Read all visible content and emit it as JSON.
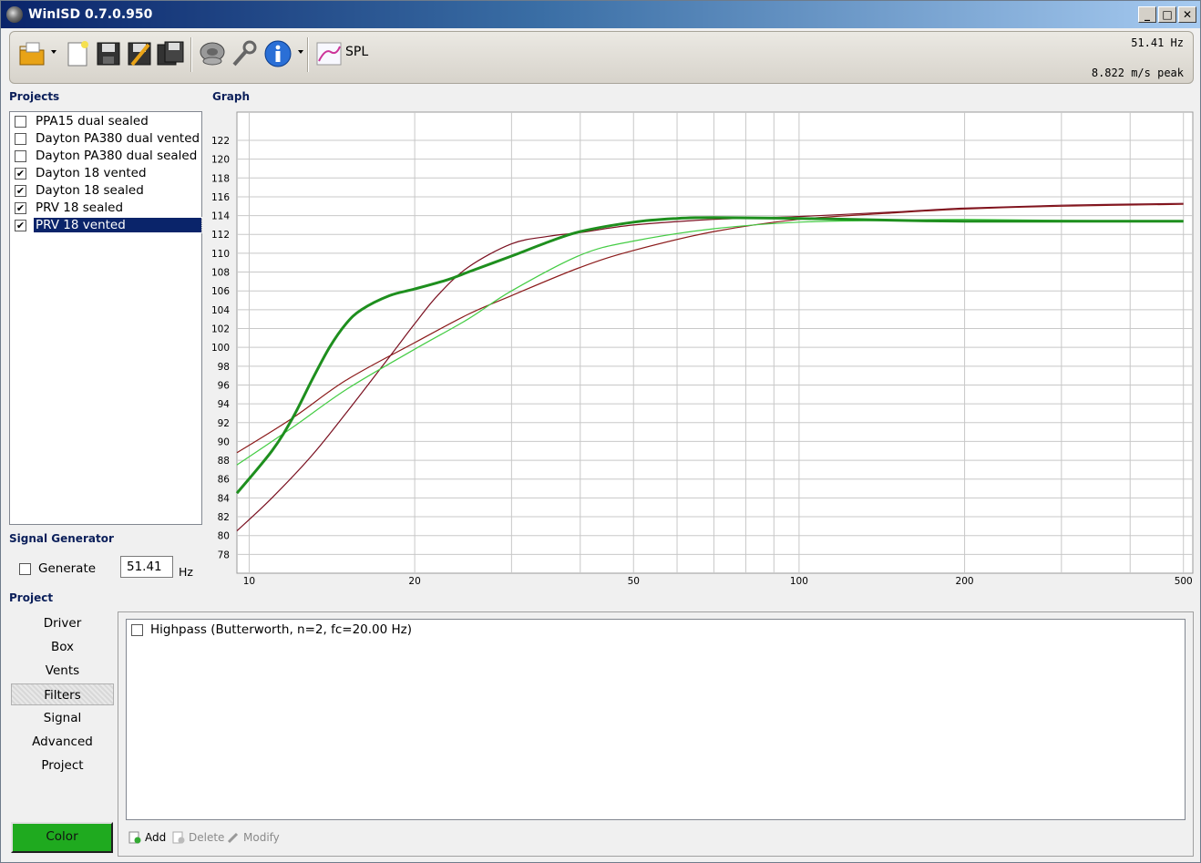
{
  "window": {
    "title": "WinISD 0.7.0.950",
    "min": "_",
    "max": "□",
    "close": "✕"
  },
  "toolbar": {
    "icons": [
      "open-folder-icon",
      "new-file-icon",
      "save-icon",
      "save-as-icon",
      "save-all-icon",
      "speaker-icon",
      "wrench-icon",
      "info-icon",
      "spl-graph-icon"
    ],
    "graph_label": "SPL",
    "frequency_readout": "51.41 Hz",
    "excursion_readout": "8.822 m/s peak"
  },
  "projects": {
    "label": "Projects",
    "items": [
      {
        "label": "PPA15 dual sealed",
        "checked": false,
        "selected": false
      },
      {
        "label": "Dayton PA380 dual vented",
        "checked": false,
        "selected": false
      },
      {
        "label": "Dayton PA380 dual sealed",
        "checked": false,
        "selected": false
      },
      {
        "label": "Dayton 18 vented",
        "checked": true,
        "selected": false
      },
      {
        "label": "Dayton 18 sealed",
        "checked": true,
        "selected": false
      },
      {
        "label": "PRV 18 sealed",
        "checked": true,
        "selected": false
      },
      {
        "label": "PRV 18 vented",
        "checked": true,
        "selected": true
      }
    ]
  },
  "signal_generator": {
    "label": "Signal Generator",
    "generate_label": "Generate",
    "frequency_value": "51.41",
    "unit": "Hz"
  },
  "graph": {
    "label": "Graph"
  },
  "chart_data": {
    "type": "line",
    "title": "",
    "xlabel": "",
    "ylabel": "",
    "x_scale": "log",
    "xlim": [
      9.5,
      520
    ],
    "ylim": [
      76,
      125
    ],
    "x_ticks": [
      10,
      20,
      50,
      100,
      200,
      500
    ],
    "x_gridlines": [
      10,
      20,
      30,
      40,
      50,
      60,
      70,
      80,
      90,
      100,
      200,
      300,
      400,
      500
    ],
    "y_ticks": [
      78,
      80,
      82,
      84,
      86,
      88,
      90,
      92,
      94,
      96,
      98,
      100,
      102,
      104,
      106,
      108,
      110,
      112,
      114,
      116,
      118,
      120,
      122
    ],
    "grid": true,
    "legend": "none",
    "series": [
      {
        "color": "#8b1a1a",
        "width": 1.2,
        "points": [
          [
            9.5,
            88.8
          ],
          [
            12,
            92.5
          ],
          [
            15,
            96.5
          ],
          [
            20,
            100.5
          ],
          [
            25,
            103.5
          ],
          [
            30,
            105.5
          ],
          [
            40,
            108.5
          ],
          [
            50,
            110.3
          ],
          [
            70,
            112.3
          ],
          [
            100,
            113.6
          ],
          [
            150,
            114.3
          ],
          [
            200,
            114.7
          ],
          [
            300,
            115
          ],
          [
            500,
            115.2
          ]
        ]
      },
      {
        "color": "#7a1020",
        "width": 1.2,
        "points": [
          [
            9.5,
            80.5
          ],
          [
            11,
            84
          ],
          [
            13,
            88.5
          ],
          [
            15,
            93
          ],
          [
            18,
            99
          ],
          [
            20,
            102.5
          ],
          [
            22,
            105.5
          ],
          [
            25,
            108.5
          ],
          [
            30,
            111
          ],
          [
            35,
            111.8
          ],
          [
            40,
            112.2
          ],
          [
            50,
            113
          ],
          [
            70,
            113.6
          ],
          [
            100,
            113.9
          ],
          [
            150,
            114.4
          ],
          [
            200,
            114.8
          ],
          [
            300,
            115.1
          ],
          [
            500,
            115.3
          ]
        ]
      },
      {
        "color": "#44cc44",
        "width": 1.2,
        "points": [
          [
            9.5,
            87.5
          ],
          [
            12,
            91.5
          ],
          [
            15,
            95.5
          ],
          [
            20,
            99.8
          ],
          [
            25,
            103
          ],
          [
            30,
            106
          ],
          [
            40,
            109.8
          ],
          [
            50,
            111.3
          ],
          [
            70,
            112.6
          ],
          [
            100,
            113.3
          ],
          [
            150,
            113.5
          ],
          [
            200,
            113.6
          ],
          [
            300,
            113.5
          ],
          [
            500,
            113.4
          ]
        ]
      },
      {
        "color": "#1e8f1e",
        "width": 3,
        "points": [
          [
            9.5,
            84.5
          ],
          [
            11,
            89
          ],
          [
            12,
            92.5
          ],
          [
            13,
            96.5
          ],
          [
            14,
            100
          ],
          [
            15,
            102.5
          ],
          [
            16,
            104
          ],
          [
            18,
            105.5
          ],
          [
            20,
            106.2
          ],
          [
            23,
            107.2
          ],
          [
            25,
            108
          ],
          [
            30,
            109.7
          ],
          [
            35,
            111.2
          ],
          [
            40,
            112.3
          ],
          [
            50,
            113.3
          ],
          [
            60,
            113.7
          ],
          [
            70,
            113.8
          ],
          [
            100,
            113.7
          ],
          [
            150,
            113.5
          ],
          [
            200,
            113.4
          ],
          [
            300,
            113.4
          ],
          [
            500,
            113.4
          ]
        ]
      }
    ]
  },
  "project": {
    "label": "Project",
    "tabs": [
      {
        "label": "Driver",
        "active": false
      },
      {
        "label": "Box",
        "active": false
      },
      {
        "label": "Vents",
        "active": false
      },
      {
        "label": "Filters",
        "active": true
      },
      {
        "label": "Signal",
        "active": false
      },
      {
        "label": "Advanced",
        "active": false
      },
      {
        "label": "Project",
        "active": false
      }
    ],
    "color_button": "Color",
    "color_value": "#1faa1f"
  },
  "filters": {
    "items": [
      {
        "label": "Highpass (Butterworth, n=2, fc=20.00 Hz)",
        "checked": false
      }
    ],
    "add_label": "Add",
    "delete_label": "Delete",
    "modify_label": "Modify"
  }
}
